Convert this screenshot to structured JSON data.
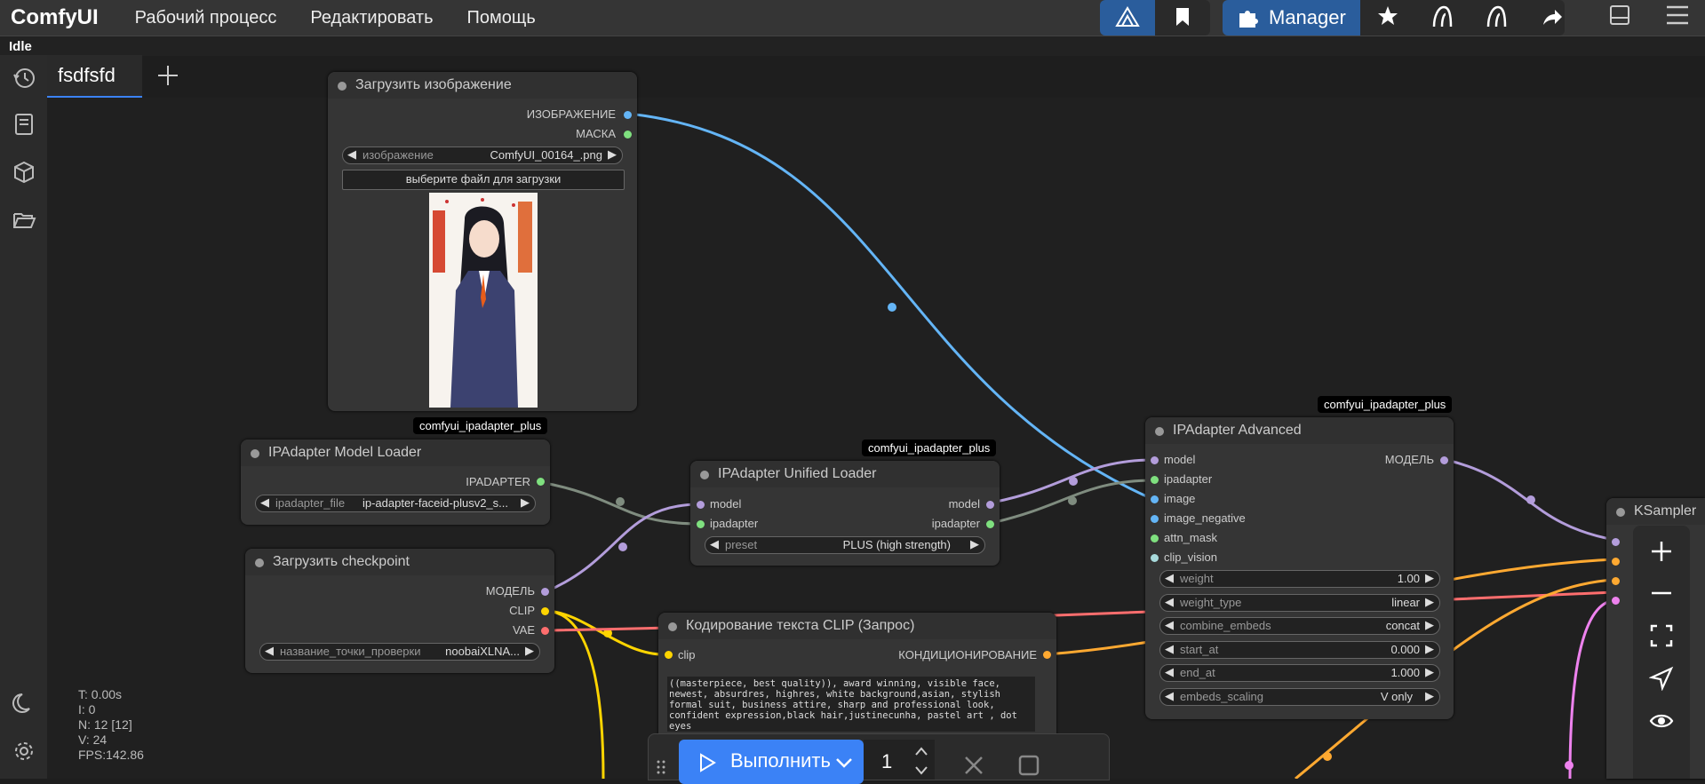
{
  "app": {
    "name": "ComfyUI",
    "status": "Idle"
  },
  "menu": [
    "Рабочий процесс",
    "Редактировать",
    "Помощь"
  ],
  "topbar_right": {
    "manager_label": "Manager"
  },
  "tabs": [
    {
      "label": "fsdfsfd"
    }
  ],
  "nodes": {
    "load_image": {
      "title": "Загрузить изображение",
      "outputs": [
        "ИЗОБРАЖЕНИЕ",
        "МАСКА"
      ],
      "widget_label": "изображение",
      "widget_value": "ComfyUI_00164_.png",
      "upload_label": "выберите файл для загрузки"
    },
    "model_loader": {
      "badge": "comfyui_ipadapter_plus",
      "title": "IPAdapter Model Loader",
      "output": "IPADAPTER",
      "widget_label": "ipadapter_file",
      "widget_value": "ip-adapter-faceid-plusv2_s..."
    },
    "checkpoint": {
      "title": "Загрузить checkpoint",
      "outputs": [
        "МОДЕЛЬ",
        "CLIP",
        "VAE"
      ],
      "widget_label": "название_точки_проверки",
      "widget_value": "noobaiXLNA..."
    },
    "unified_loader": {
      "badge": "comfyui_ipadapter_plus",
      "title": "IPAdapter Unified Loader",
      "inputs": [
        "model",
        "ipadapter"
      ],
      "outputs": [
        "model",
        "ipadapter"
      ],
      "widget_label": "preset",
      "widget_value": "PLUS (high strength)"
    },
    "clip_text": {
      "title": "Кодирование текста CLIP (Запрос)",
      "input": "clip",
      "output": "КОНДИЦИОНИРОВАНИЕ",
      "text": "((masterpiece, best quality)), award winning, visible face, newest, absurdres, highres, white background,asian, stylish formal suit, business attire, sharp and professional look, confident expression,black hair,justinecunha, pastel art , dot eyes"
    },
    "ipadapter_advanced": {
      "badge": "comfyui_ipadapter_plus",
      "title": "IPAdapter Advanced",
      "inputs": [
        "model",
        "ipadapter",
        "image",
        "image_negative",
        "attn_mask",
        "clip_vision"
      ],
      "output": "МОДЕЛЬ",
      "widgets": [
        {
          "label": "weight",
          "value": "1.00"
        },
        {
          "label": "weight_type",
          "value": "linear"
        },
        {
          "label": "combine_embeds",
          "value": "concat"
        },
        {
          "label": "start_at",
          "value": "0.000"
        },
        {
          "label": "end_at",
          "value": "1.000"
        },
        {
          "label": "embeds_scaling",
          "value": "V only"
        }
      ]
    },
    "ksampler": {
      "title": "KSampler"
    }
  },
  "stats": {
    "t": "T: 0.00s",
    "i": "I: 0",
    "n": "N: 12 [12]",
    "v": "V: 24",
    "fps": "FPS:142.86"
  },
  "action": {
    "run_label": "Выполнить",
    "count": "1"
  },
  "colors": {
    "accent": "#3b82f6",
    "model": "#b39ddb",
    "clip": "#ffd500",
    "vae": "#ff6e6e",
    "image": "#64b5f6",
    "conditioning": "#ffa931",
    "ipadapter": "#7fe07f"
  }
}
